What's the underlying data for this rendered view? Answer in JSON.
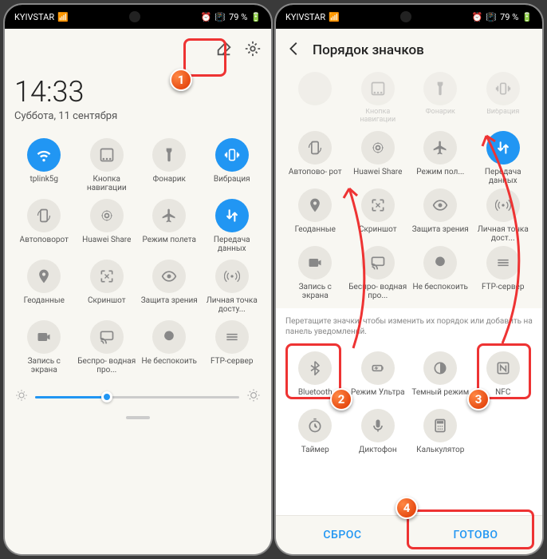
{
  "statusbar": {
    "carrier": "KYIVSTAR",
    "battery": "79 %"
  },
  "left": {
    "time": "14:33",
    "date": "Суббота, 11 сентября",
    "tiles": [
      {
        "label": "tplink5g",
        "active": true,
        "icon": "wifi"
      },
      {
        "label": "Кнопка навигации",
        "active": false,
        "icon": "nav"
      },
      {
        "label": "Фонарик",
        "active": false,
        "icon": "flashlight"
      },
      {
        "label": "Вибрация",
        "active": true,
        "icon": "vibrate"
      },
      {
        "label": "Автоповорот",
        "active": false,
        "icon": "rotate"
      },
      {
        "label": "Huawei Share",
        "active": false,
        "icon": "share"
      },
      {
        "label": "Режим полета",
        "active": false,
        "icon": "airplane"
      },
      {
        "label": "Передача данных",
        "active": true,
        "icon": "data"
      },
      {
        "label": "Геоданные",
        "active": false,
        "icon": "location"
      },
      {
        "label": "Скриншот",
        "active": false,
        "icon": "screenshot"
      },
      {
        "label": "Защита зрения",
        "active": false,
        "icon": "eye"
      },
      {
        "label": "Личная точка досту...",
        "active": false,
        "icon": "hotspot"
      },
      {
        "label": "Запись с экрана",
        "active": false,
        "icon": "record"
      },
      {
        "label": "Беспро- водная про...",
        "active": false,
        "icon": "cast"
      },
      {
        "label": "Не беспокоить",
        "active": false,
        "icon": "dnd"
      },
      {
        "label": "FTP-сервер",
        "active": false,
        "icon": "ftp"
      }
    ]
  },
  "right": {
    "title": "Порядок значков",
    "fade_row": [
      {
        "label": "",
        "icon": ""
      },
      {
        "label": "Кнопка навигации",
        "icon": "nav"
      },
      {
        "label": "Фонарик",
        "icon": "flashlight"
      },
      {
        "label": "Вибрация",
        "icon": "vibrate"
      }
    ],
    "rows": [
      {
        "label": "Автопово- рот",
        "icon": "rotate"
      },
      {
        "label": "Huawei Share",
        "icon": "share"
      },
      {
        "label": "Режим пол...",
        "icon": "airplane"
      },
      {
        "label": "Передача данных",
        "icon": "data",
        "active": true
      },
      {
        "label": "Геоданные",
        "icon": "location"
      },
      {
        "label": "Скриншот",
        "icon": "screenshot"
      },
      {
        "label": "Защита зрения",
        "icon": "eye"
      },
      {
        "label": "Личная точка дост...",
        "icon": "hotspot"
      },
      {
        "label": "Запись с экрана",
        "icon": "record"
      },
      {
        "label": "Беспро- водная про...",
        "icon": "cast"
      },
      {
        "label": "Не беспокоить",
        "icon": "dnd"
      },
      {
        "label": "FTP-сервер",
        "icon": "ftp"
      }
    ],
    "hint": "Перетащите значки, чтобы изменить их порядок или добавить на панель уведомлений.",
    "extra": [
      {
        "label": "Bluetooth",
        "icon": "bluetooth"
      },
      {
        "label": "Режим Ультра",
        "icon": "ultra"
      },
      {
        "label": "Темный режим",
        "icon": "dark"
      },
      {
        "label": "NFC",
        "icon": "nfc"
      },
      {
        "label": "Таймер",
        "icon": "timer"
      },
      {
        "label": "Диктофон",
        "icon": "mic"
      },
      {
        "label": "Калькулятор",
        "icon": "calc"
      }
    ],
    "reset": "СБРОС",
    "done": "ГОТОВО"
  },
  "badges": {
    "b1": "1",
    "b2": "2",
    "b3": "3",
    "b4": "4"
  }
}
